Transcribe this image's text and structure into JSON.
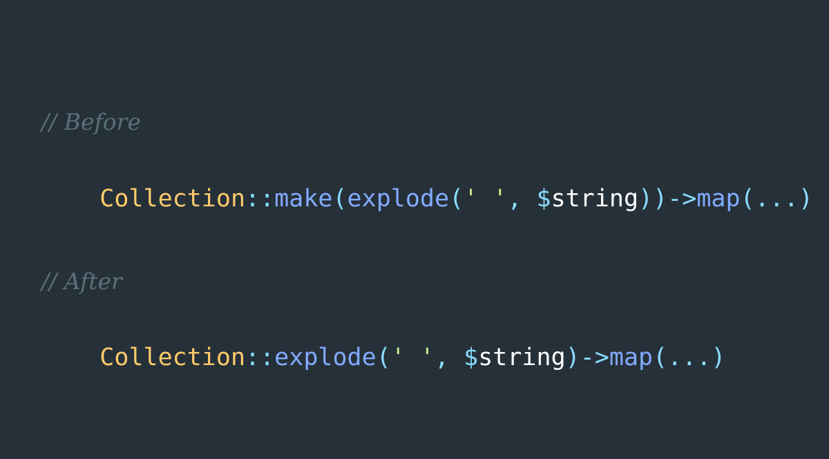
{
  "colors": {
    "background": "#263038",
    "comment": "#5b7079",
    "class": "#ffcb6b",
    "operator": "#89ddff",
    "function": "#82aaff",
    "string": "#c3e88d",
    "variable": "#ffffff",
    "punctuation": "#89ddff"
  },
  "snippet": {
    "before": {
      "comment": "// Before",
      "tokens": [
        {
          "text": "Collection",
          "kind": "class"
        },
        {
          "text": "::",
          "kind": "operator"
        },
        {
          "text": "make",
          "kind": "function"
        },
        {
          "text": "(",
          "kind": "punctuation"
        },
        {
          "text": "explode",
          "kind": "function"
        },
        {
          "text": "(",
          "kind": "punctuation"
        },
        {
          "text": "' '",
          "kind": "string"
        },
        {
          "text": ", ",
          "kind": "punctuation"
        },
        {
          "text": "$",
          "kind": "operator"
        },
        {
          "text": "string",
          "kind": "variable"
        },
        {
          "text": "))",
          "kind": "punctuation"
        },
        {
          "text": "->",
          "kind": "operator"
        },
        {
          "text": "map",
          "kind": "function"
        },
        {
          "text": "(...)",
          "kind": "punctuation"
        }
      ]
    },
    "after": {
      "comment": "// After",
      "tokens": [
        {
          "text": "Collection",
          "kind": "class"
        },
        {
          "text": "::",
          "kind": "operator"
        },
        {
          "text": "explode",
          "kind": "function"
        },
        {
          "text": "(",
          "kind": "punctuation"
        },
        {
          "text": "' '",
          "kind": "string"
        },
        {
          "text": ", ",
          "kind": "punctuation"
        },
        {
          "text": "$",
          "kind": "operator"
        },
        {
          "text": "string",
          "kind": "variable"
        },
        {
          "text": ")",
          "kind": "punctuation"
        },
        {
          "text": "->",
          "kind": "operator"
        },
        {
          "text": "map",
          "kind": "function"
        },
        {
          "text": "(...)",
          "kind": "punctuation"
        }
      ]
    }
  }
}
